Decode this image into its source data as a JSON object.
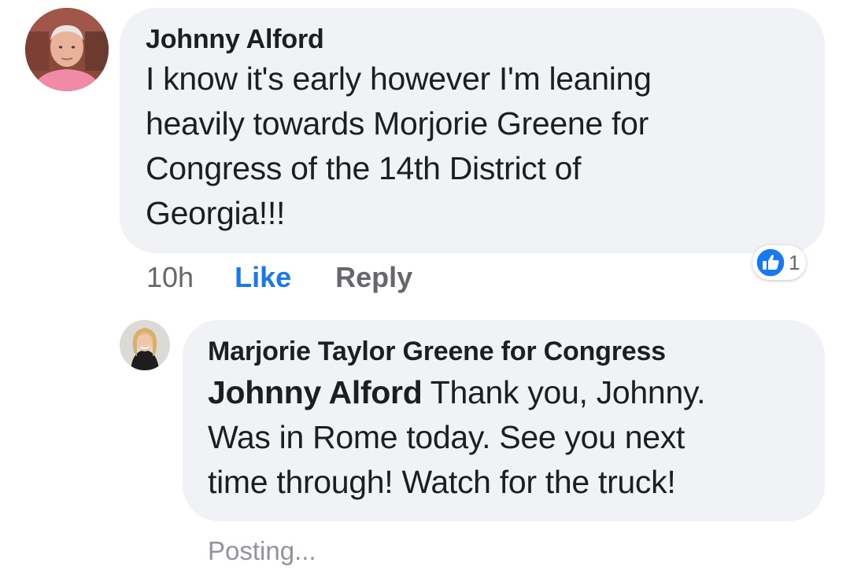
{
  "comment": {
    "author": "Johnny Alford",
    "text": "I know it's early however I'm leaning heavily towards Morjorie Greene for Congress of the 14th District of Georgia!!!",
    "lines": [
      "I know it's early however I'm leaning",
      "heavily towards Morjorie Greene for",
      "Congress of the 14th District of",
      "Georgia!!!"
    ],
    "avatar_icon": "profile-photo-older-man",
    "reaction": {
      "icon": "thumbs-up-icon",
      "count": "1",
      "color": "#1877f2"
    },
    "actions": {
      "time": "10h",
      "like_label": "Like",
      "reply_label": "Reply"
    }
  },
  "reply": {
    "author": "Marjorie Taylor Greene for Congress",
    "mention": "Johnny Alford",
    "lines": [
      " Thank you, Johnny.",
      "Was in Rome today. See you next",
      "time through! Watch for the truck!"
    ],
    "avatar_icon": "profile-photo-woman",
    "status": "Posting..."
  },
  "colors": {
    "bubble_bg": "#f0f2f5",
    "text": "#1c1e21",
    "secondary_text": "#65676b",
    "accent": "#1877f2"
  }
}
